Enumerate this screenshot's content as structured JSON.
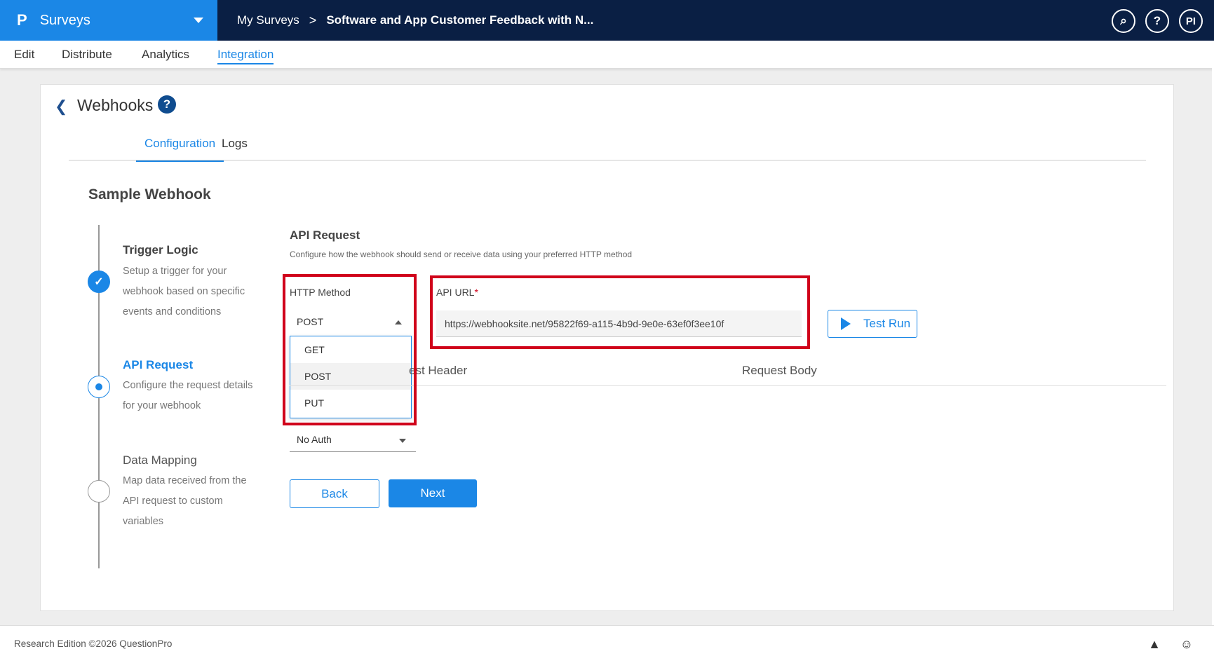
{
  "app": {
    "logo": "P",
    "product": "Surveys"
  },
  "breadcrumb": {
    "root": "My Surveys",
    "separator": ">",
    "current": "Software and App Customer Feedback with N..."
  },
  "top_icons": [
    {
      "name": "search-icon",
      "glyph": "⌕"
    },
    {
      "name": "help-icon",
      "glyph": "?"
    },
    {
      "name": "profile-avatar",
      "glyph": "PI"
    }
  ],
  "nav": {
    "tabs": [
      "Edit",
      "Distribute",
      "Analytics",
      "Integration"
    ],
    "active": "Integration"
  },
  "page": {
    "title": "Webhooks",
    "help": "?",
    "subtabs": [
      "Configuration",
      "Logs"
    ],
    "section_title": "Sample Webhook"
  },
  "steps": [
    {
      "title": "Trigger Logic",
      "desc": "Setup a trigger for your webhook based on specific events and conditions",
      "state": "done"
    },
    {
      "title": "API Request",
      "desc": "Configure the request details for your webhook",
      "state": "current"
    },
    {
      "title": "Data Mapping",
      "desc": "Map data received from the API request to custom variables",
      "state": "pending"
    }
  ],
  "form": {
    "title": "API Request",
    "desc": "Configure how the webhook should send or receive data using your preferred HTTP method",
    "http_method_label": "HTTP Method",
    "http_method_value": "POST",
    "http_options": [
      "GET",
      "POST",
      "PUT"
    ],
    "api_url_label": "API URL",
    "required_mark": "*",
    "api_url_value": "https://webhooksite.net/95822f69-a115-4b9d-9e0e-63ef0f3ee10f",
    "test_run": "Test Run",
    "request_tabs": [
      "est Header",
      "Request Body"
    ],
    "auth_value": "No Auth",
    "back": "Back",
    "next": "Next"
  },
  "footer": {
    "text": "Research Edition ©2026 QuestionPro"
  },
  "colors": {
    "primary": "#1b87e6",
    "topbar": "#0a1f44",
    "highlight": "#d0021b"
  }
}
